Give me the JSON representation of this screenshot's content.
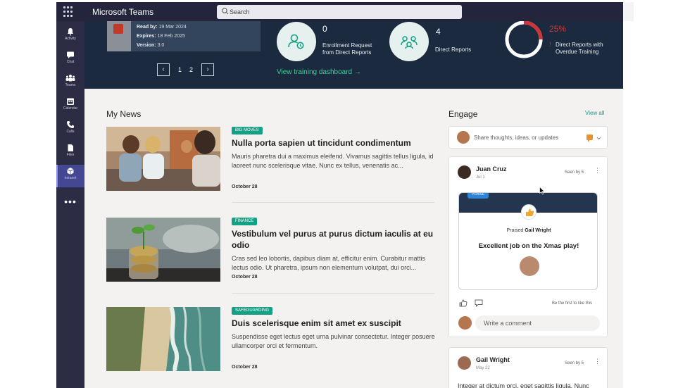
{
  "app": {
    "title": "Microsoft Teams"
  },
  "search": {
    "placeholder": "Search"
  },
  "rail": {
    "items": [
      {
        "label": "Activity",
        "icon": "bell-icon"
      },
      {
        "label": "Chat",
        "icon": "chat-icon"
      },
      {
        "label": "Teams",
        "icon": "teams-icon"
      },
      {
        "label": "Calendar",
        "icon": "calendar-icon"
      },
      {
        "label": "Calls",
        "icon": "phone-icon"
      },
      {
        "label": "Files",
        "icon": "file-icon"
      },
      {
        "label": "Intranet",
        "icon": "intranet-icon",
        "active": true
      }
    ],
    "more": "•••"
  },
  "hero": {
    "training": {
      "read_by_label": "Read by:",
      "read_by": "19 Mar 2024",
      "expires_label": "Expires:",
      "expires": "18 Feb 2025",
      "version_label": "Version:",
      "version": "3.0"
    },
    "pager": {
      "pages": [
        "1",
        "2"
      ],
      "prev": "‹",
      "next": "›"
    },
    "stats": [
      {
        "value": "0",
        "label_1": "Enrollment Request",
        "label_2": "from Direct Reports",
        "icon": "person-clock-icon"
      },
      {
        "value": "4",
        "label_1": "Direct Reports",
        "label_2": "",
        "icon": "people-network-icon"
      }
    ],
    "overdue": {
      "percent": "25%",
      "percent_value": 25,
      "mark": "!",
      "label_1": "Direct Reports with",
      "label_2": "Overdue Training"
    },
    "view_dashboard": "View training dashboard →"
  },
  "news": {
    "title": "My News",
    "items": [
      {
        "tag": "BIG MOVES",
        "headline": "Nulla porta sapien ut tincidunt condimentum",
        "summary": "Mauris pharetra dui a maximus eleifend. Vivamus sagittis tellus ligula, id laoreet nunc scelerisque vitae. Nunc ex tellus, venenatis ac...",
        "date": "October 28",
        "image": "group-meeting-photo"
      },
      {
        "tag": "FINANCE",
        "headline": "Vestibulum vel purus at purus dictum iaculis at eu odio",
        "summary": "Cras sed leo lobortis, dapibus diam at, efficitur enim. Curabitur mattis lectus odio. Ut pharetra, ipsum non elementum volutpat, dui orci...",
        "date": "October 28",
        "image": "coins-plant-photo"
      },
      {
        "tag": "SAFEGUARDING",
        "headline": "Duis scelerisque enim sit amet ex suscipit",
        "summary": "Suspendisse eget lectus eget urna pulvinar consectetur. Integer posuere ullamcorper orci et fermentum.",
        "date": "October 28",
        "image": "aerial-beach-photo"
      }
    ]
  },
  "engage": {
    "title": "Engage",
    "view_all": "View all",
    "composer_placeholder": "Share thoughts, ideas, or updates",
    "posts": [
      {
        "author": "Juan Cruz",
        "date": "Jul 1",
        "seen": "Seen by 5",
        "menu": "⋮",
        "praise": {
          "tag": "PRAISE",
          "praised_prefix": "Praised",
          "praised_name": "Gail Wright",
          "message": "Excellent job on the Xmas play!"
        },
        "first_like": "Be the first to like this",
        "comment_placeholder": "Write a comment"
      },
      {
        "author": "Gail Wright",
        "date": "May 22",
        "seen": "Seen by 5",
        "menu": "⋮",
        "text": "Integer at dictum orci, eget sagittis ligula. Nunc"
      }
    ]
  },
  "colors": {
    "teams_topbar": "#24243d",
    "teams_rail": "#2d2c45",
    "hero_bg": "#1b2a3f",
    "accent_green": "#13a085",
    "alert_red": "#d13438",
    "praise_blue": "#2f83d8"
  }
}
